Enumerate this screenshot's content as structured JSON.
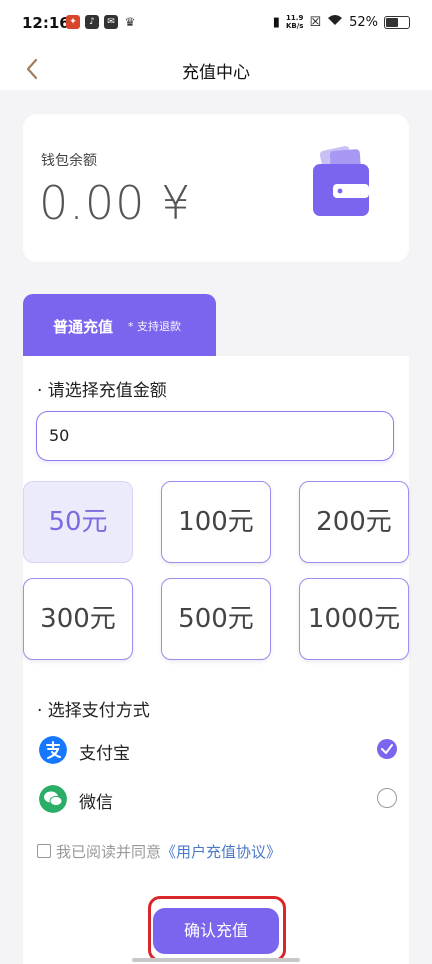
{
  "status_bar": {
    "time": "12:16",
    "net_speed_value": "11.9",
    "net_speed_unit": "KB/s",
    "battery_percent": "52%"
  },
  "nav": {
    "title": "充值中心",
    "back_icon": "chevron-left-icon"
  },
  "wallet": {
    "label": "钱包余额",
    "balance": "0.00 ¥",
    "icon": "wallet-icon"
  },
  "tabs": [
    {
      "label": "普通充值",
      "note": "* 支持退款",
      "active": true
    }
  ],
  "recharge": {
    "section_title": "· 请选择充值金额",
    "input_value": "50",
    "amount_options": [
      {
        "label": "50元",
        "selected": true
      },
      {
        "label": "100元",
        "selected": false
      },
      {
        "label": "200元",
        "selected": false
      },
      {
        "label": "300元",
        "selected": false
      },
      {
        "label": "500元",
        "selected": false
      },
      {
        "label": "1000元",
        "selected": false
      }
    ]
  },
  "payment": {
    "section_title": "· 选择支付方式",
    "methods": [
      {
        "name": "支付宝",
        "icon": "alipay-icon",
        "color": "#1677ff",
        "selected": true
      },
      {
        "name": "微信",
        "icon": "wechat-icon",
        "color": "#2aae67",
        "selected": false
      }
    ]
  },
  "agreement": {
    "text": "我已阅读并同意",
    "link": "《用户充值协议》",
    "checked": false
  },
  "confirm_label": "确认充值",
  "colors": {
    "accent": "#7b64ee",
    "selected_bg": "#ecebfb",
    "highlight": "#d8262a",
    "link": "#4b79c9"
  }
}
